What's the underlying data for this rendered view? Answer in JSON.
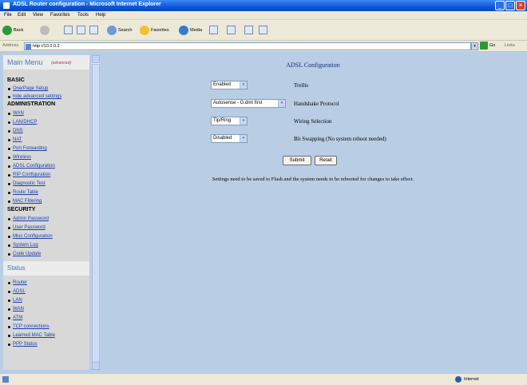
{
  "window": {
    "title": "ADSL Router configuration - Microsoft Internet Explorer"
  },
  "menubar": [
    "File",
    "Edit",
    "View",
    "Favorites",
    "Tools",
    "Help"
  ],
  "toolbar": {
    "back": "Back",
    "search": "Search",
    "favorites": "Favorites",
    "media": "Media"
  },
  "address": {
    "label": "Address",
    "url": "http://10.0.0.2",
    "go": "Go",
    "links": "Links"
  },
  "sidebar": {
    "main_menu": "Main Menu",
    "main_menu_tag": "(advanced)",
    "basic_heading": "BASIC",
    "basic_items": [
      "One/Page Setup",
      "hide advanced settings"
    ],
    "admin_heading": "ADMINISTRATION",
    "admin_items": [
      "WAN",
      "LAN/DHCP",
      "DNS",
      "NAT",
      "Port Forwarding",
      "Wireless",
      "ADSL Configuration",
      "RIP Configuration",
      "Diagnostic Test",
      "Route Table",
      "MAC Filtering"
    ],
    "security_heading": "SECURITY",
    "security_items": [
      "Admin Password",
      "User Password",
      "Misc Configuration",
      "System Log",
      "Code Update"
    ],
    "status_heading": "Status",
    "status_items": [
      "Router",
      "ADSL",
      "LAN",
      "WAN",
      "ATM",
      "TCP connections",
      "Learned MAC Table",
      "PPP Status"
    ]
  },
  "main": {
    "title": "ADSL Configuration",
    "rows": [
      {
        "value": "Enabled",
        "label": "Trellis"
      },
      {
        "value": "Autosense - G.dmt first",
        "label": "Handshake Protocol"
      },
      {
        "value": "Tip/Ring",
        "label": "Wiring Selection"
      },
      {
        "value": "Disabled",
        "label": "Bit Swapping (No system reboot needed)"
      }
    ],
    "submit": "Submit",
    "reset": "Reset",
    "note": "Settings need to be saved to Flash and the system needs to be rebooted for changes to take effect."
  },
  "status": {
    "zone": "Internet"
  }
}
